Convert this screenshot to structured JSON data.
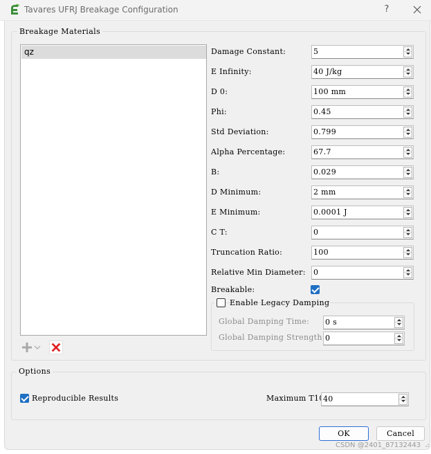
{
  "window": {
    "title": "Tavares UFRJ Breakage Configuration",
    "help_glyph": "?",
    "close_icon": "close-icon",
    "app_icon": "leaf-app-icon"
  },
  "materials": {
    "group_title": "Breakage Materials",
    "items": [
      "qz"
    ],
    "selected": "qz",
    "add_icon": "plus-icon",
    "add_menu_icon": "chevron-down-icon",
    "delete_icon": "red-x-icon"
  },
  "params": [
    {
      "label": "Damage Constant:",
      "value": "5"
    },
    {
      "label": "E Infinity:",
      "value": "40 J/kg"
    },
    {
      "label": "D 0:",
      "value": "100 mm"
    },
    {
      "label": "Phi:",
      "value": "0.45"
    },
    {
      "label": "Std Deviation:",
      "value": "0.799"
    },
    {
      "label": "Alpha Percentage:",
      "value": "67.7"
    },
    {
      "label": "B:",
      "value": "0.029"
    },
    {
      "label": "D Minimum:",
      "value": "2 mm"
    },
    {
      "label": "E Minimum:",
      "value": "0.0001 J"
    },
    {
      "label": "C T:",
      "value": "0"
    },
    {
      "label": "Truncation Ratio:",
      "value": "100"
    },
    {
      "label": "Relative Min Diameter:",
      "value": "0"
    }
  ],
  "breakable": {
    "label": "Breakable:",
    "checked": true
  },
  "legacy": {
    "label": "Enable Legacy Damping",
    "checked": false,
    "fields": [
      {
        "label": "Global Damping Time:",
        "value": "0 s"
      },
      {
        "label": "Global Damping Strength:",
        "value": "0"
      }
    ]
  },
  "options": {
    "group_title": "Options",
    "reproducible": {
      "label": "Reproducible Results",
      "checked": true
    },
    "max_t10": {
      "label": "Maximum T10:",
      "value": "40"
    }
  },
  "buttons": {
    "ok": "OK",
    "cancel": "Cancel"
  },
  "watermark": "CSDN @2401_87132443",
  "colors": {
    "accent": "#1f6fc3",
    "delete": "#e02020",
    "app_icon": "#3b8f3b"
  }
}
